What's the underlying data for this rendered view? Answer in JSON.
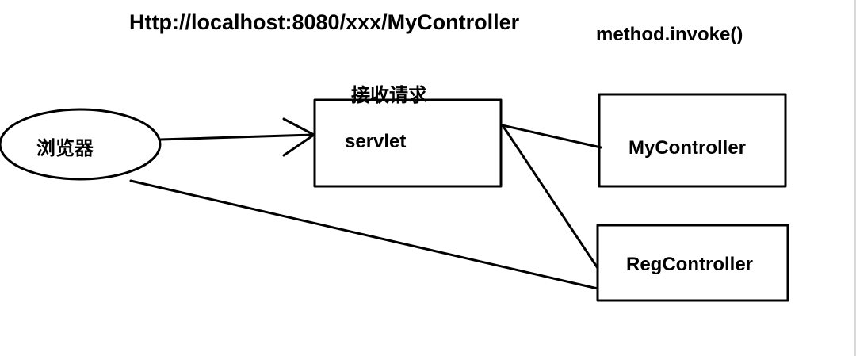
{
  "diagram": {
    "url_label": "Http://localhost:8080/xxx/MyController",
    "invoke_label": "method.invoke()",
    "receive_label": "接收请求",
    "browser_label": "浏览器",
    "servlet_label": "servlet",
    "my_controller_label": "MyController",
    "reg_controller_label": "RegController"
  }
}
